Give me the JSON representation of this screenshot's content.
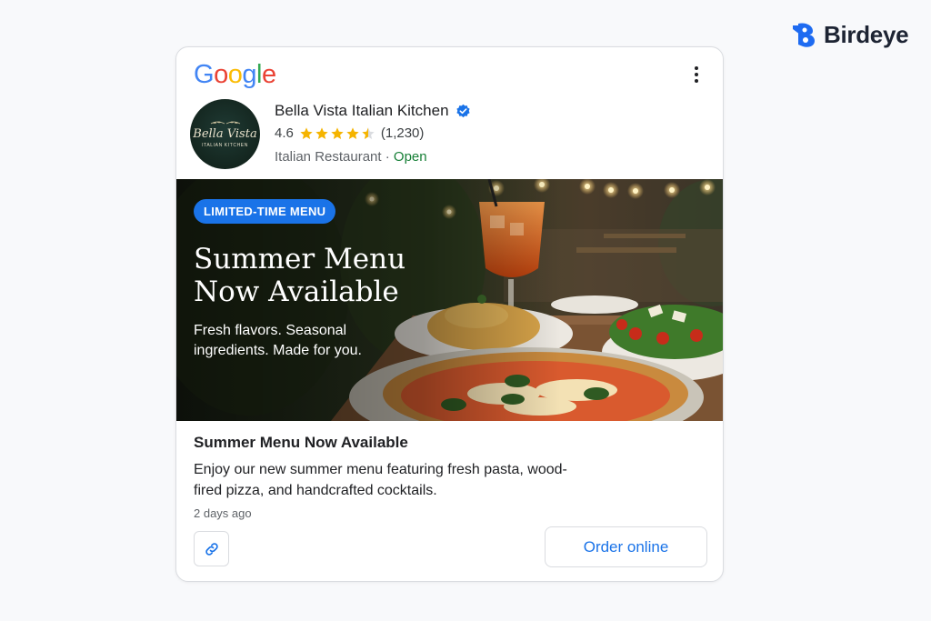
{
  "brand": {
    "name": "Birdeye",
    "icon": "birdeye-logo-icon",
    "color": "#1e6bf1"
  },
  "card": {
    "google_logo": {
      "letters": [
        "G",
        "o",
        "o",
        "g",
        "l",
        "e"
      ],
      "colors": [
        "#4285F4",
        "#EA4335",
        "#FBBC05",
        "#4285F4",
        "#34A853",
        "#EA4335"
      ]
    },
    "menu_icon": "more-vert-icon",
    "business": {
      "logo_text": "Bella Vista",
      "logo_subtext": "ITALIAN KITCHEN",
      "name": "Bella Vista Italian Kitchen",
      "verified_icon": "verified-badge-icon",
      "rating": "4.6",
      "stars_filled": 4.5,
      "reviews": "(1,230)",
      "category": "Italian Restaurant",
      "separator": " · ",
      "status": "Open",
      "status_color": "#188038"
    },
    "hero": {
      "badge": "LIMITED-TIME MENU",
      "title_line1": "Summer Menu",
      "title_line2": "Now Available",
      "subtitle": "Fresh flavors. Seasonal ingredients. Made for you."
    },
    "post": {
      "title": "Summer Menu Now Available",
      "body": "Enjoy our new summer menu featuring fresh pasta, wood-fired pizza, and handcrafted cocktails.",
      "time": "2 days ago",
      "link_icon": "link-icon",
      "cta": "Order online"
    },
    "accent_color": "#1a73e8"
  }
}
